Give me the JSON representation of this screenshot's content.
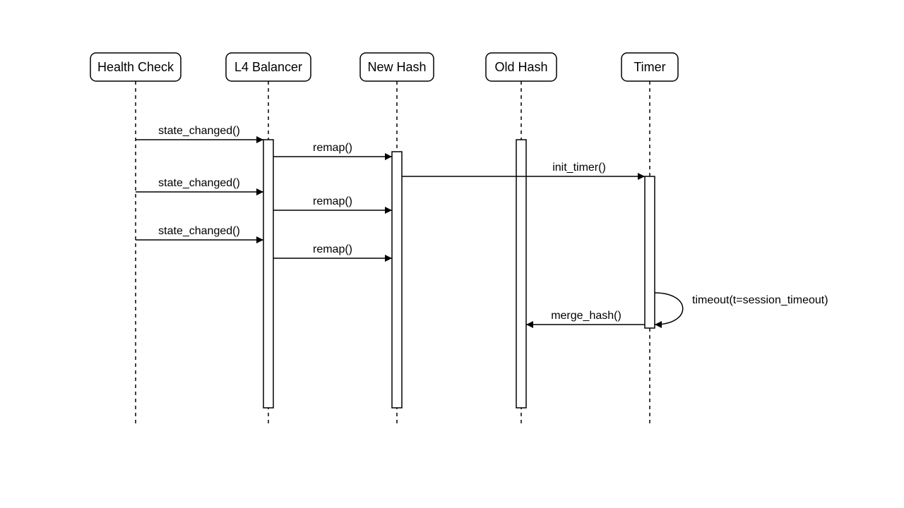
{
  "diagram": {
    "type": "sequence",
    "actors": {
      "health_check": "Health Check",
      "l4_balancer": "L4 Balancer",
      "new_hash": "New Hash",
      "old_hash": "Old Hash",
      "timer": "Timer"
    },
    "messages": {
      "state_changed_1": "state_changed()",
      "remap_1": "remap()",
      "init_timer": "init_timer()",
      "state_changed_2": "state_changed()",
      "remap_2": "remap()",
      "state_changed_3": "state_changed()",
      "remap_3": "remap()",
      "timeout": "timeout(t=session_timeout)",
      "merge_hash": "merge_hash()"
    }
  }
}
